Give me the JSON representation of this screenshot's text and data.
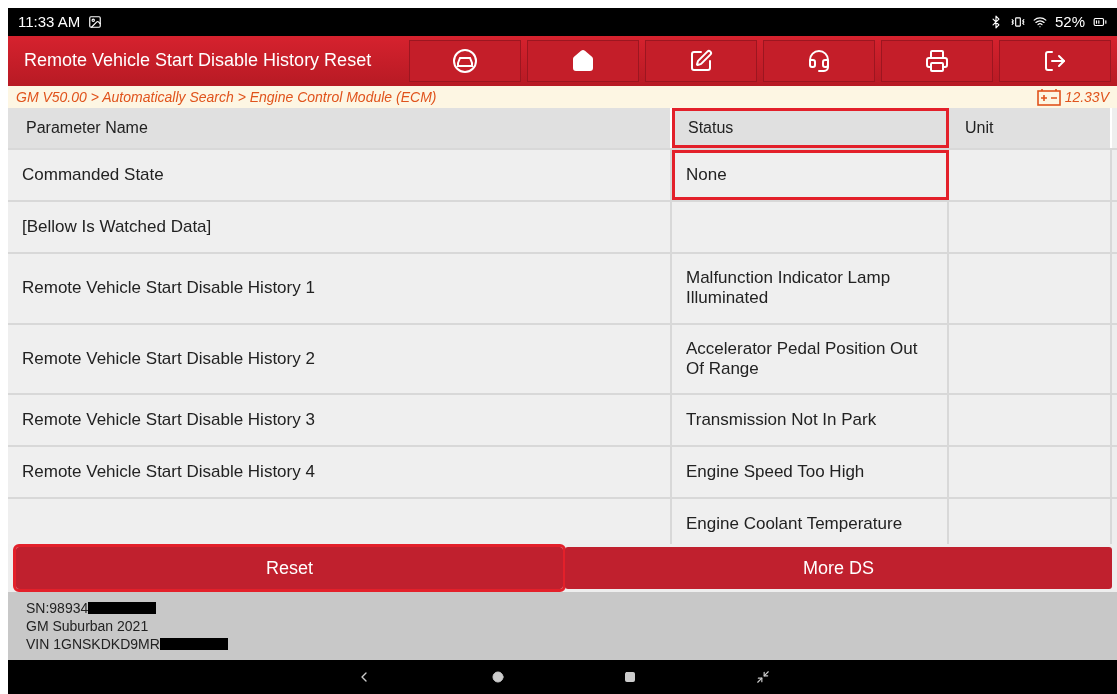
{
  "status_bar": {
    "time": "11:33 AM",
    "battery": "52%"
  },
  "header": {
    "title": "Remote Vehicle Start Disable History Reset",
    "tools": [
      {
        "kind": "car"
      },
      {
        "kind": "home"
      },
      {
        "kind": "edit"
      },
      {
        "kind": "support"
      },
      {
        "kind": "print"
      },
      {
        "kind": "exit"
      }
    ]
  },
  "breadcrumb": {
    "path": "GM V50.00 > Automatically Search > Engine Control Module (ECM)",
    "voltage": "12.33V"
  },
  "table": {
    "columns": [
      {
        "label": "Parameter Name",
        "highlighted": false
      },
      {
        "label": "Status",
        "highlighted": true
      },
      {
        "label": "Unit",
        "highlighted": false
      }
    ],
    "rows": [
      {
        "parameter": "Commanded State",
        "status": "None",
        "status_highlighted": true
      },
      {
        "parameter": "[Bellow Is Watched Data]"
      },
      {
        "parameter": "Remote Vehicle Start Disable History 1",
        "status": "Malfunction Indicator Lamp Illuminated"
      },
      {
        "parameter": "Remote Vehicle Start Disable History 2",
        "status": "Accelerator Pedal Position Out Of Range"
      },
      {
        "parameter": "Remote Vehicle Start Disable History 3",
        "status": "Transmission Not In Park"
      },
      {
        "parameter": "Remote Vehicle Start Disable History 4",
        "status": "Engine Speed Too High"
      },
      {
        "status": "Engine Coolant Temperature"
      }
    ]
  },
  "buttons": [
    {
      "label": "Reset",
      "highlighted": true
    },
    {
      "label": "More DS",
      "highlighted": false
    }
  ],
  "info": [
    {
      "text": "SN:98934",
      "redacted": true
    },
    {
      "text": "GM Suburban 2021",
      "redacted": false
    },
    {
      "text": "VIN 1GNSKDKD9MR",
      "redacted": true
    }
  ]
}
